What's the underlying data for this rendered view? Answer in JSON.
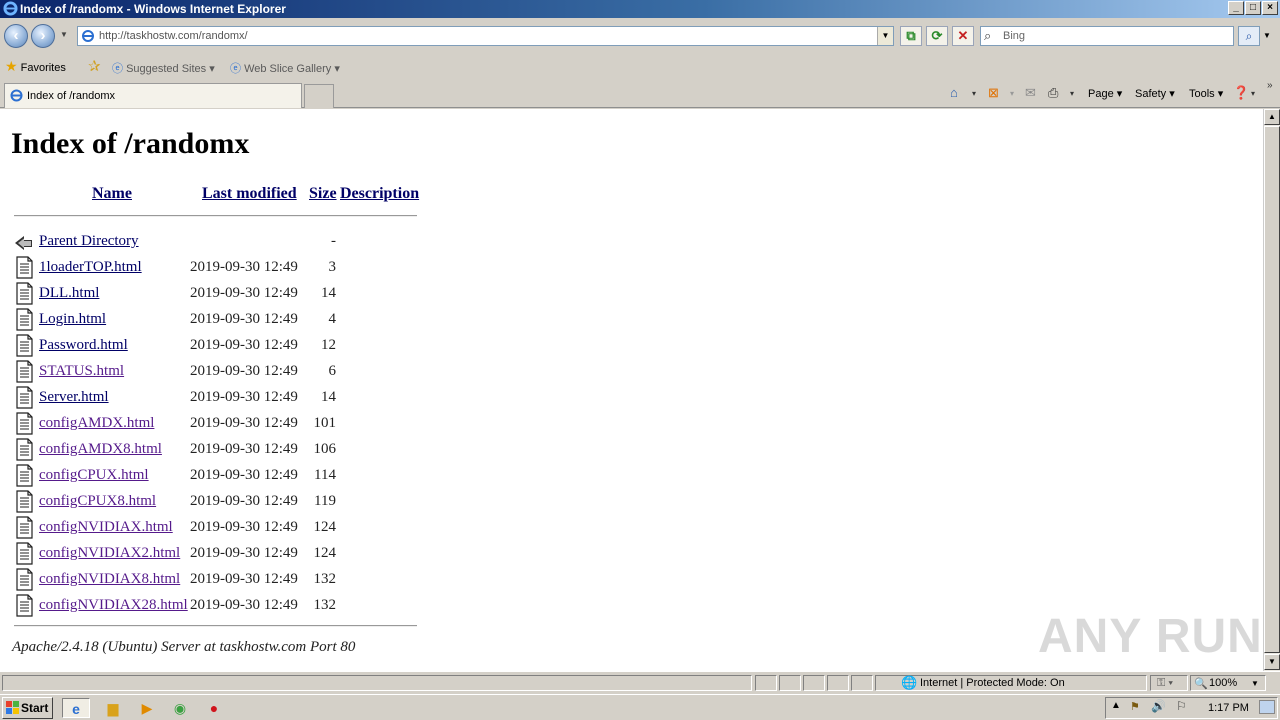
{
  "window": {
    "title": "Index of /randomx - Windows Internet Explorer",
    "min": "_",
    "max": "□",
    "close": "×"
  },
  "addressbar": {
    "url": "http://taskhostw.com/randomx/",
    "search_placeholder": "Bing"
  },
  "favorites": {
    "label": "Favorites",
    "items": [
      "Suggested Sites",
      "Web Slice Gallery"
    ]
  },
  "tab": {
    "label": "Index of /randomx"
  },
  "commandbar": {
    "page": "Page",
    "safety": "Safety",
    "tools": "Tools"
  },
  "page": {
    "heading": "Index of /randomx",
    "columns": {
      "name": "Name",
      "modified": "Last modified",
      "size": "Size",
      "description": "Description"
    },
    "parent": {
      "name": "Parent Directory",
      "size": "-"
    },
    "files": [
      {
        "name": "1loaderTOP.html",
        "date": "2019-09-30 12:49",
        "size": "3",
        "visited": false
      },
      {
        "name": "DLL.html",
        "date": "2019-09-30 12:49",
        "size": "14",
        "visited": false
      },
      {
        "name": "Login.html",
        "date": "2019-09-30 12:49",
        "size": "4",
        "visited": false
      },
      {
        "name": "Password.html",
        "date": "2019-09-30 12:49",
        "size": "12",
        "visited": false
      },
      {
        "name": "STATUS.html",
        "date": "2019-09-30 12:49",
        "size": "6",
        "visited": true
      },
      {
        "name": "Server.html",
        "date": "2019-09-30 12:49",
        "size": "14",
        "visited": false
      },
      {
        "name": "configAMDX.html",
        "date": "2019-09-30 12:49",
        "size": "101",
        "visited": true
      },
      {
        "name": "configAMDX8.html",
        "date": "2019-09-30 12:49",
        "size": "106",
        "visited": true
      },
      {
        "name": "configCPUX.html",
        "date": "2019-09-30 12:49",
        "size": "114",
        "visited": true
      },
      {
        "name": "configCPUX8.html",
        "date": "2019-09-30 12:49",
        "size": "119",
        "visited": true
      },
      {
        "name": "configNVIDIAX.html",
        "date": "2019-09-30 12:49",
        "size": "124",
        "visited": true
      },
      {
        "name": "configNVIDIAX2.html",
        "date": "2019-09-30 12:49",
        "size": "124",
        "visited": true
      },
      {
        "name": "configNVIDIAX8.html",
        "date": "2019-09-30 12:49",
        "size": "132",
        "visited": true
      },
      {
        "name": "configNVIDIAX28.html",
        "date": "2019-09-30 12:49",
        "size": "132",
        "visited": true
      }
    ],
    "address": "Apache/2.4.18 (Ubuntu) Server at taskhostw.com Port 80"
  },
  "watermark": "ANY RUN",
  "statusbar": {
    "zone": "Internet | Protected Mode: On",
    "zoom": "100%"
  },
  "taskbar": {
    "start": "Start",
    "clock": "1:17 PM"
  }
}
